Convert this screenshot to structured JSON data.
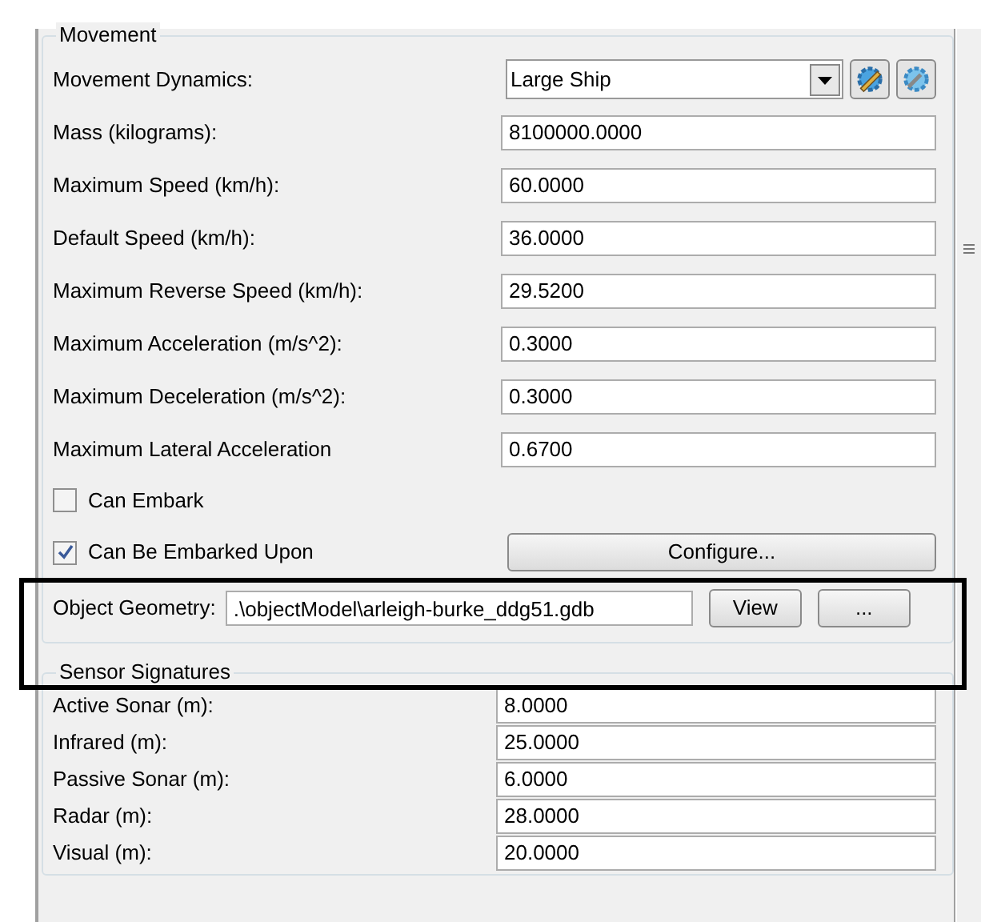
{
  "movement": {
    "title": "Movement",
    "dynamics": {
      "label": "Movement Dynamics:",
      "value": "Large Ship"
    },
    "fields": [
      {
        "label": "Mass (kilograms):",
        "value": "8100000.0000"
      },
      {
        "label": "Maximum Speed (km/h):",
        "value": "60.0000"
      },
      {
        "label": "Default Speed (km/h):",
        "value": "36.0000"
      },
      {
        "label": "Maximum Reverse Speed (km/h):",
        "value": "29.5200"
      },
      {
        "label": "Maximum Acceleration (m/s^2):",
        "value": "0.3000"
      },
      {
        "label": "Maximum Deceleration (m/s^2):",
        "value": "0.3000"
      },
      {
        "label": "Maximum Lateral Acceleration",
        "value": "0.6700"
      }
    ],
    "can_embark": {
      "label": "Can Embark",
      "checked": false
    },
    "can_be_embarked": {
      "label": "Can Be Embarked Upon",
      "checked": true,
      "button": "Configure..."
    },
    "geometry": {
      "label": "Object Geometry:",
      "value": ".\\objectModel\\arleigh-burke_ddg51.gdb",
      "buttons": [
        "View",
        "..."
      ]
    }
  },
  "sensor_signatures": {
    "title": "Sensor Signatures",
    "fields": [
      {
        "label": "Active Sonar (m):",
        "value": "8.0000"
      },
      {
        "label": "Infrared (m):",
        "value": "25.0000"
      },
      {
        "label": "Passive Sonar (m):",
        "value": "6.0000"
      },
      {
        "label": "Radar (m):",
        "value": "28.0000"
      },
      {
        "label": "Visual (m):",
        "value": "20.0000"
      }
    ]
  }
}
